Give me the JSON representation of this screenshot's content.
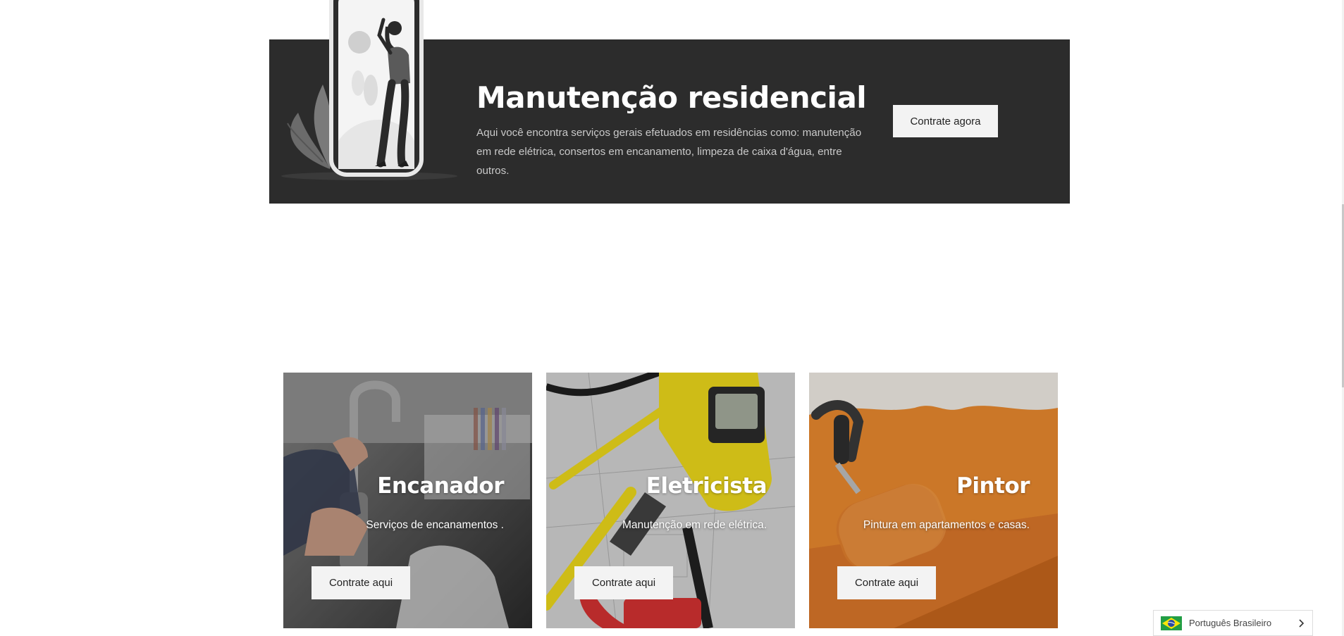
{
  "hero": {
    "title": "Manutenção residencial",
    "description": "Aqui você encontra serviços gerais efetuados em residências como: manutenção em rede elétrica, consertos em encanamento, limpeza de caixa d'água, entre outros.",
    "button_label": "Contrate agora",
    "background_color": "#2c2c2c",
    "illustration_icon": "woman-phone-illustration"
  },
  "services": [
    {
      "title": "Encanador",
      "description": "Serviços de encanamentos .",
      "button_label": "Contrate aqui",
      "image": "plumber-faucet-photo"
    },
    {
      "title": "Eletricista",
      "description": "Manutenção em rede elétrica.",
      "button_label": "Contrate aqui",
      "image": "electrician-tools-photo"
    },
    {
      "title": "Pintor",
      "description": "Pintura em apartamentos e casas.",
      "button_label": "Contrate aqui",
      "image": "paint-roller-photo"
    }
  ],
  "language_selector": {
    "label": "Português Brasileiro",
    "flag_icon": "brazil-flag-icon",
    "chevron_icon": "chevron-right-icon"
  },
  "colors": {
    "button_bg": "#f3f3f3",
    "accent_orange": "#e8882e",
    "accent_yellow": "#f2dd1c"
  }
}
